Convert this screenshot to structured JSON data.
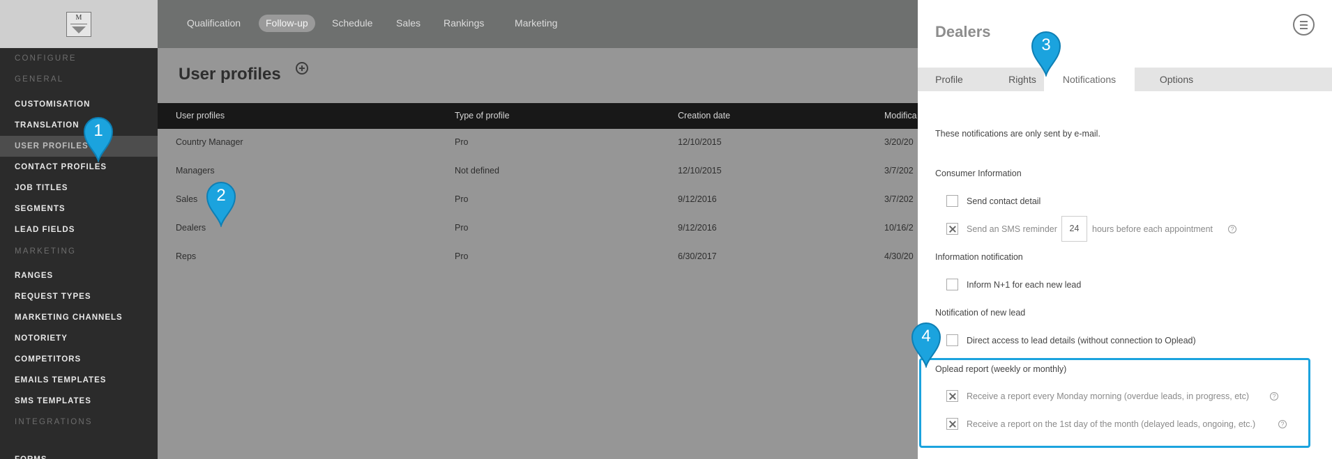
{
  "sidebar": {
    "items": [
      {
        "label": "CONFIGURE",
        "type": "head"
      },
      {
        "label": "GENERAL",
        "type": "head"
      },
      {
        "label": "CUSTOMISATION",
        "type": "item"
      },
      {
        "label": "TRANSLATION",
        "type": "item"
      },
      {
        "label": "USER PROFILES",
        "type": "item",
        "active": true
      },
      {
        "label": "CONTACT PROFILES",
        "type": "item"
      },
      {
        "label": "JOB TITLES",
        "type": "item"
      },
      {
        "label": "SEGMENTS",
        "type": "item"
      },
      {
        "label": "LEAD FIELDS",
        "type": "item"
      },
      {
        "label": "MARKETING",
        "type": "head"
      },
      {
        "label": "RANGES",
        "type": "item"
      },
      {
        "label": "REQUEST TYPES",
        "type": "item"
      },
      {
        "label": "MARKETING CHANNELS",
        "type": "item"
      },
      {
        "label": "NOTORIETY",
        "type": "item"
      },
      {
        "label": "COMPETITORS",
        "type": "item"
      },
      {
        "label": "EMAILS TEMPLATES",
        "type": "item"
      },
      {
        "label": "SMS TEMPLATES",
        "type": "item"
      },
      {
        "label": "INTEGRATIONS",
        "type": "head"
      },
      {
        "label": "FORMS",
        "type": "item"
      }
    ]
  },
  "topnav": {
    "tabs": [
      {
        "label": "Qualification"
      },
      {
        "label": "Follow-up",
        "active": true
      },
      {
        "label": "Schedule"
      },
      {
        "label": "Sales"
      },
      {
        "label": "Rankings"
      },
      {
        "label": "Marketing"
      }
    ]
  },
  "main": {
    "title": "User profiles",
    "table": {
      "columns": [
        "User profiles",
        "Type of profile",
        "Creation date",
        "Modifica"
      ],
      "rows": [
        [
          "Country Manager",
          "Pro",
          "12/10/2015",
          "3/20/20"
        ],
        [
          "Managers",
          "Not defined",
          "12/10/2015",
          "3/7/202"
        ],
        [
          "Sales",
          "Pro",
          "9/12/2016",
          "3/7/202"
        ],
        [
          "Dealers",
          "Pro",
          "9/12/2016",
          "10/16/2"
        ],
        [
          "Reps",
          "Pro",
          "6/30/2017",
          "4/30/20"
        ]
      ]
    }
  },
  "panel": {
    "title": "Dealers",
    "tabs": [
      {
        "label": "Profile"
      },
      {
        "label": "Rights"
      },
      {
        "label": "Notifications",
        "active": true
      },
      {
        "label": "Options"
      }
    ],
    "intro": "These notifications are only sent by e-mail.",
    "sections": {
      "consumer": "Consumer Information",
      "info": "Information notification",
      "newlead": "Notification of new lead",
      "report": "Oplead report (weekly or monthly)"
    },
    "options": {
      "send_contact": {
        "label": "Send contact detail",
        "checked": false
      },
      "sms_reminder": {
        "label_before": "Send an SMS reminder",
        "hours": "24",
        "label_after": "hours before each appointment",
        "checked": true
      },
      "inform_n1": {
        "label": "Inform N+1 for each new lead",
        "checked": false
      },
      "direct_access": {
        "label": "Direct access to lead details (without connection to Oplead)",
        "checked": false
      },
      "weekly_report": {
        "label": "Receive a report every Monday morning (overdue leads, in progress, etc)",
        "checked": true
      },
      "monthly_report": {
        "label": "Receive a report on the 1st day of the month (delayed leads, ongoing, etc.)",
        "checked": true
      }
    },
    "help_glyph": "?"
  },
  "callouts": [
    "1",
    "2",
    "3",
    "4"
  ],
  "logo": {
    "letter": "M"
  },
  "colors": {
    "accent": "#1ba3de",
    "sidebar": "#2b2b2b",
    "topbar": "#6e706f",
    "overlay": "#969696"
  }
}
